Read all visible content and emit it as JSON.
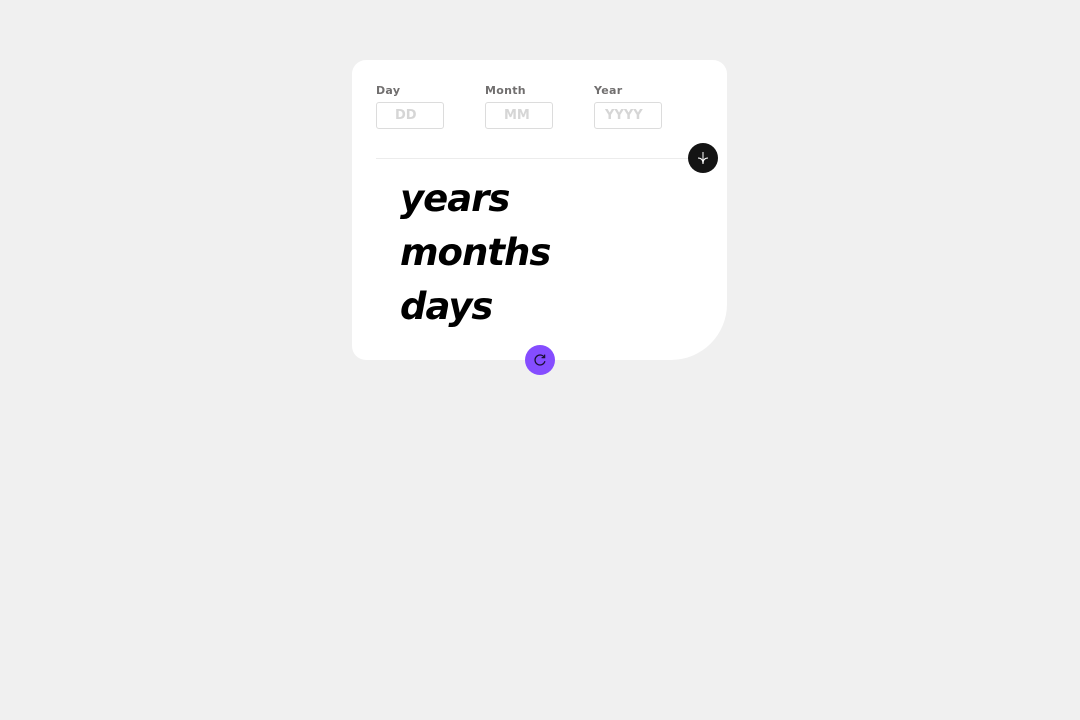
{
  "form": {
    "day": {
      "label": "Day",
      "value": "",
      "placeholder": "DD"
    },
    "month": {
      "label": "Month",
      "value": "",
      "placeholder": "MM"
    },
    "year": {
      "label": "Year",
      "value": "",
      "placeholder": "YYYY"
    }
  },
  "submit": {
    "icon": "arrow-down-icon",
    "color": "#141414"
  },
  "results": {
    "years_label": "years",
    "months_label": "months",
    "days_label": "days"
  },
  "reset": {
    "icon": "refresh-icon",
    "color": "#854dff"
  },
  "colors": {
    "background": "#f0f0f0",
    "card": "#ffffff",
    "label": "#716f6f",
    "accent": "#854dff"
  }
}
